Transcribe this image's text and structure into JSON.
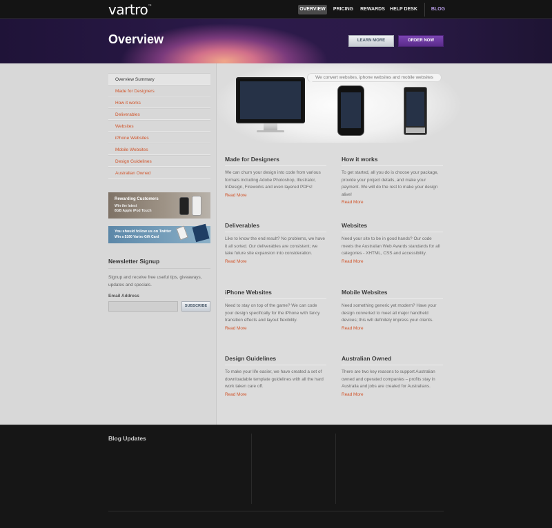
{
  "header": {
    "logo": "vartro",
    "logo_tm": "™",
    "nav": [
      "OVERVIEW",
      "PRICING",
      "REWARDS",
      "HELP DESK",
      "BLOG"
    ]
  },
  "hero": {
    "title": "Overview",
    "learn_more": "LEARN MORE",
    "order_now": "ORDER NOW"
  },
  "sidebar": {
    "items": [
      "Overview Summary",
      "Made for Designers",
      "How it works",
      "Deliverables",
      "Websites",
      "iPhone Websites",
      "Mobile Websites",
      "Design Guidelines",
      "Australian Owned"
    ],
    "promo1": {
      "line1": "Rewarding Customers",
      "line2": "Win the latest",
      "line3": "8GB Apple iPod Touch"
    },
    "promo2": {
      "line1": "You should follow us on Twitter",
      "line2": "Win a $160 Vartro Gift Card"
    },
    "newsletter": {
      "title": "Newsletter Signup",
      "text": "Signup and receive free useful tips, giveaways, updates and specials.",
      "email_label": "Email Address",
      "email_value": "",
      "subscribe": "SUBSCRIBE"
    }
  },
  "devices": {
    "bubble": "We convert websites, iphone websites and mobile websites"
  },
  "features": [
    {
      "title": "Made for Designers",
      "text": "We can churn your design into code from various formats including Adobe Photoshop, Illustrator, InDesign, Fireworks and even layered PDFs!",
      "more": "Read More"
    },
    {
      "title": "How it works",
      "text": "To get started, all you do is choose your package, provide your project details, and make your payment. We will do the rest to make your design alive!",
      "more": "Read More"
    },
    {
      "title": "Deliverables",
      "text": "Like to know the end result? No problems, we have it all sorted. Our deliverables are consistent; we take future site expansion into consideration.",
      "more": "Read More"
    },
    {
      "title": "Websites",
      "text": "Need your site to be in good hands? Our code meets the Australian Web Awards standards for all categories - XHTML, CSS and accessibility.",
      "more": "Read More"
    },
    {
      "title": "iPhone Websites",
      "text": "Need to stay on top of the game? We can code your design specifically for the iPhone with fancy transition effects and layout flexibility.",
      "more": "Read More"
    },
    {
      "title": "Mobile Websites",
      "text": "Need something generic yet modern? Have your design converted to meet all major handheld devices; this will definitely impress your clients.",
      "more": "Read More"
    },
    {
      "title": "Design Guidelines",
      "text": "To make your life easier, we have created a set of downloadable template guidelines with all the hard work taken care off.",
      "more": "Read More"
    },
    {
      "title": "Australian Owned",
      "text": "There are two key reasons to support Australian owned and operated companies – profits stay in Australia and jobs are created for Australians.",
      "more": "Read More"
    }
  ],
  "footer": {
    "blog_title": "Blog Updates"
  },
  "colors": {
    "accent": "#d0542a",
    "purple": "#6b3aa0",
    "footer_bg": "#161616"
  }
}
